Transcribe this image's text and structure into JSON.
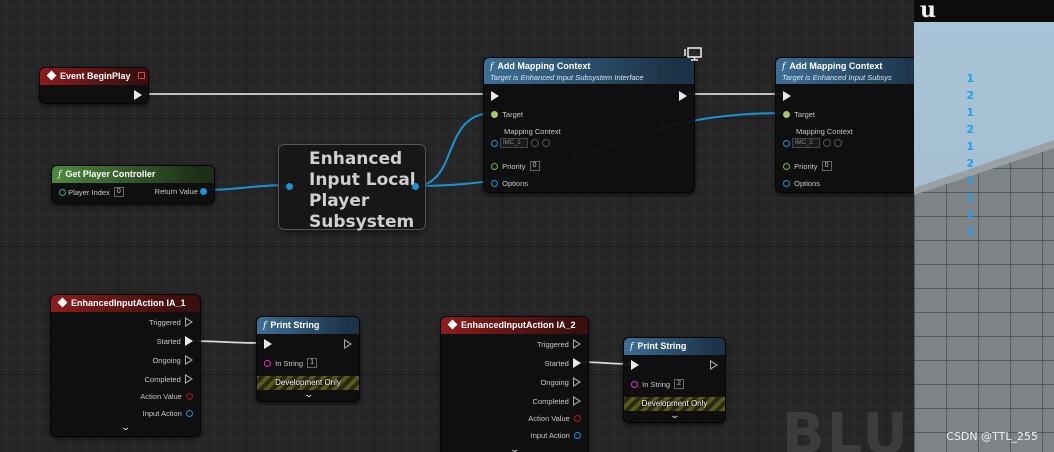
{
  "nodes": {
    "event_begin_play": {
      "title": "Event BeginPlay"
    },
    "get_player_controller": {
      "title": "Get Player Controller",
      "player_index_label": "Player Index",
      "player_index_value": "0",
      "return_label": "Return Value"
    },
    "subsystem": {
      "title_lines": [
        "Enhanced",
        "Input Local",
        "Player",
        "Subsystem"
      ]
    },
    "add_mapping_1": {
      "title": "Add Mapping Context",
      "subtitle": "Target is Enhanced Input Subsystem Interface",
      "target_label": "Target",
      "mapping_label": "Mapping Context",
      "mapping_value": "IMC_1",
      "priority_label": "Priority",
      "priority_value": "0",
      "options_label": "Options"
    },
    "add_mapping_2": {
      "title": "Add Mapping Context",
      "subtitle": "Target is Enhanced Input Subsys",
      "target_label": "Target",
      "mapping_label": "Mapping Context",
      "mapping_value": "IMC_2",
      "priority_label": "Priority",
      "priority_value": "0",
      "options_label": "Options"
    },
    "ia_1": {
      "title": "EnhancedInputAction IA_1",
      "pins": [
        "Triggered",
        "Started",
        "Ongoing",
        "Completed",
        "Action Value",
        "Input Action"
      ]
    },
    "ia_2": {
      "title": "EnhancedInputAction IA_2",
      "pins": [
        "Triggered",
        "Started",
        "Ongoing",
        "Completed",
        "Action Value",
        "Input Action"
      ]
    },
    "print_1": {
      "title": "Print String",
      "in_string_label": "In String",
      "in_string_value": "1",
      "dev_label": "Development Only"
    },
    "print_2": {
      "title": "Print String",
      "in_string_label": "In String",
      "in_string_value": "2",
      "dev_label": "Development Only"
    }
  },
  "watermark": "BLUE",
  "viewport": {
    "logo": "u",
    "print_log": [
      "1",
      "2",
      "1",
      "2",
      "1",
      "2",
      "1",
      "2",
      "1",
      "2"
    ],
    "credit": "CSDN @TTL_255"
  },
  "colors": {
    "event_header": "#8e1c1c",
    "pure_header": "#4d8a3f",
    "function_header": "#3d6f96",
    "object_wire": "#1c94d4",
    "exec_wire": "#dddddd",
    "log_text": "#1fa2e8"
  },
  "icons": [
    "event-diamond-icon",
    "function-icon",
    "monitor-icon",
    "chevron-down-icon",
    "unreal-logo-icon"
  ]
}
